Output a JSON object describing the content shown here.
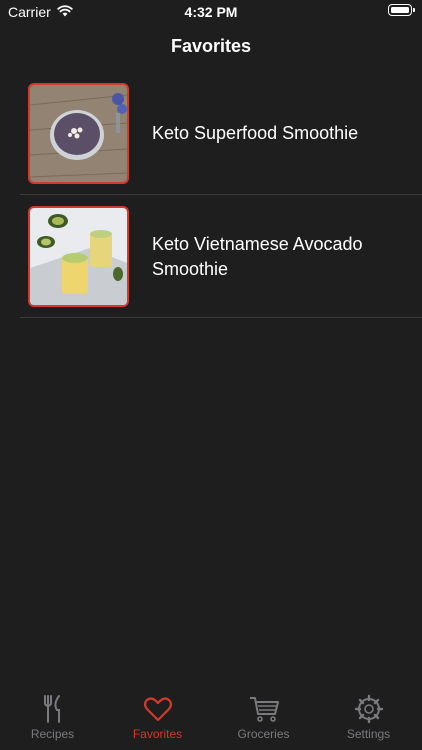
{
  "status_bar": {
    "carrier": "Carrier",
    "time": "4:32 PM"
  },
  "nav": {
    "title": "Favorites"
  },
  "favorites": [
    {
      "title": "Keto Superfood Smoothie"
    },
    {
      "title": "Keto Vietnamese Avocado Smoothie"
    }
  ],
  "tabbar": {
    "tabs": [
      {
        "label": "Recipes",
        "icon": "fork-knife-icon"
      },
      {
        "label": "Favorites",
        "icon": "heart-icon"
      },
      {
        "label": "Groceries",
        "icon": "cart-icon"
      },
      {
        "label": "Settings",
        "icon": "gear-icon"
      }
    ],
    "selected": "Favorites"
  },
  "colors": {
    "accent": "#d33a2c",
    "background": "#1e1e1f",
    "inactive": "#7a7a7e"
  }
}
